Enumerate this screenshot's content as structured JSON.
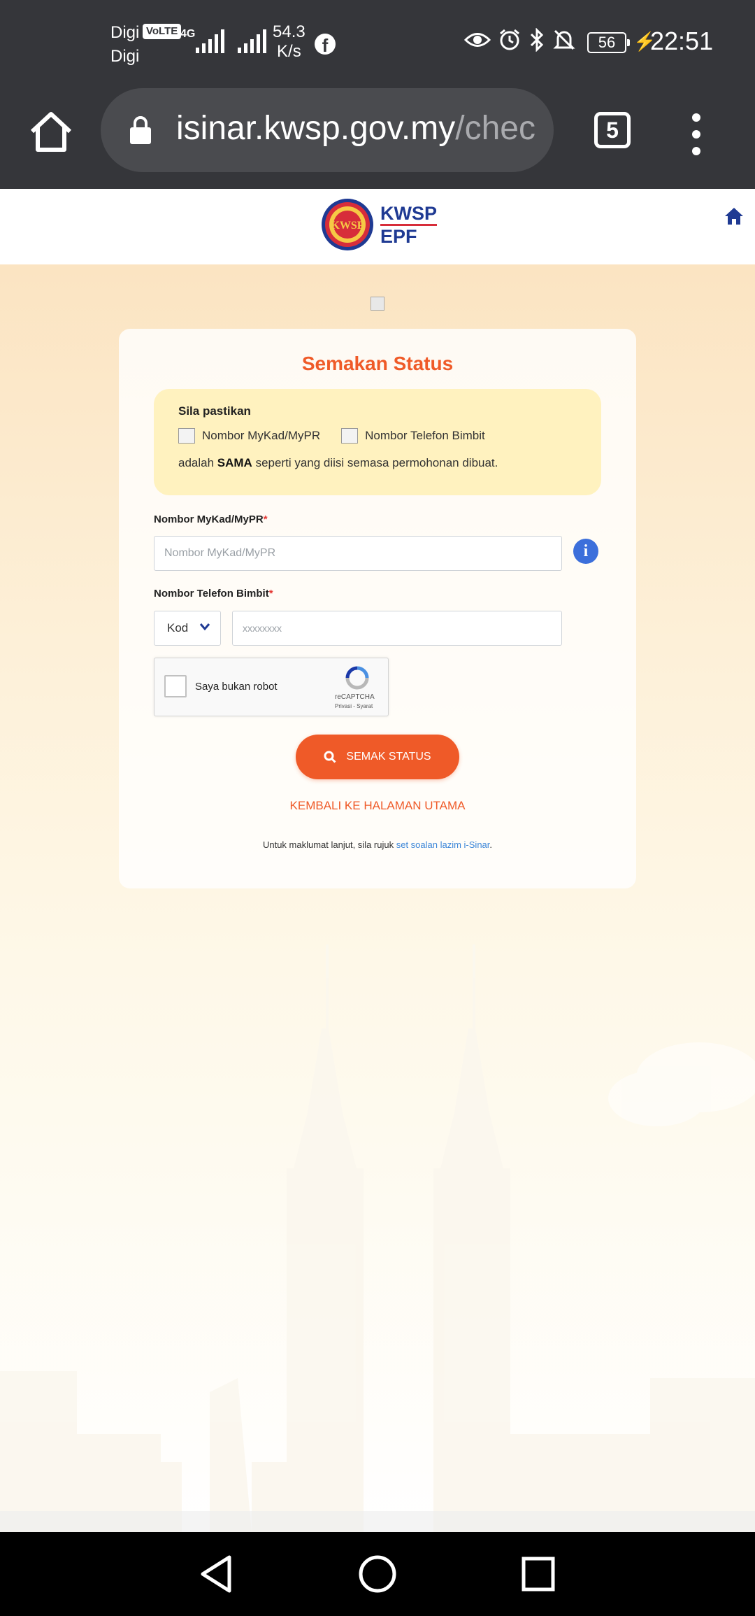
{
  "status_bar": {
    "carrier_1": "Digi",
    "carrier_2": "Digi",
    "volte": "VoLTE",
    "network": "4G",
    "speed_value": "54.3",
    "speed_unit": "K/s",
    "battery": "56",
    "time": "22:51"
  },
  "browser": {
    "url_host": "isinar.kwsp.gov.my",
    "url_path": "/chec",
    "tab_count": "5"
  },
  "header": {
    "logo_line1": "KWSP",
    "logo_line2": "EPF",
    "logo_emblem": "KWSP"
  },
  "form": {
    "title": "Semakan Status",
    "notice": {
      "heading": "Sila pastikan",
      "item_1": "Nombor MyKad/MyPR",
      "item_2": "Nombor Telefon Bimbit",
      "sentence_prefix": "adalah ",
      "sentence_bold": "SAMA",
      "sentence_suffix": " seperti yang diisi semasa permohonan dibuat."
    },
    "mykad_label": "Nombor MyKad/MyPR",
    "mykad_placeholder": "Nombor MyKad/MyPR",
    "phone_label": "Nombor Telefon Bimbit",
    "required_mark": "*",
    "phone_code": "Kod",
    "phone_placeholder": "xxxxxxxx",
    "recaptcha_label": "Saya bukan robot",
    "recaptcha_brand": "reCAPTCHA",
    "recaptcha_links": "Privasi - Syarat",
    "submit_label": "SEMAK STATUS",
    "back_link": "KEMBALI KE HALAMAN UTAMA",
    "footnote_prefix": "Untuk maklumat lanjut, sila rujuk ",
    "footnote_link": "set soalan lazim i-Sinar",
    "footnote_suffix": "."
  },
  "colors": {
    "accent": "#ef5a28",
    "brand_blue": "#1f3a93",
    "notice_bg": "#fff2bf",
    "chrome_bg": "#35363a"
  },
  "icons": [
    "home-icon",
    "lock-icon",
    "tab-switcher-icon",
    "kebab-menu-icon",
    "info-icon",
    "chevron-down-icon",
    "search-icon",
    "recaptcha-icon",
    "back-icon",
    "home-circle-icon",
    "recents-icon"
  ]
}
